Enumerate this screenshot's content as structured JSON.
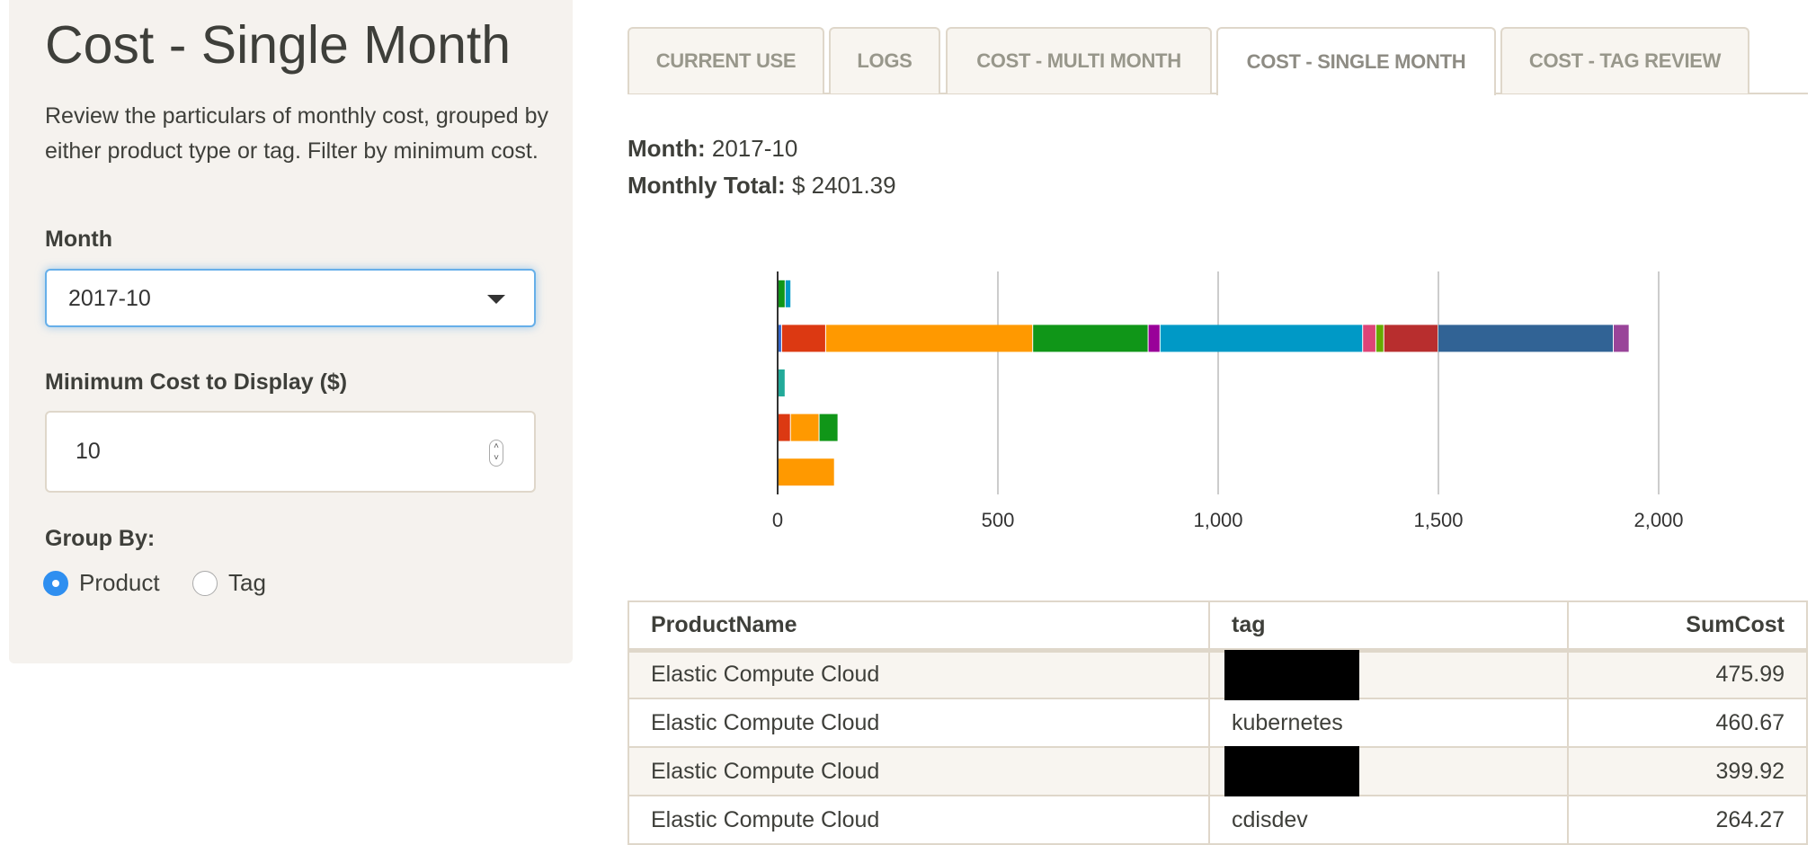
{
  "sidebar": {
    "title": "Cost - Single Month",
    "description": "Review the particulars of monthly cost, grouped by either product type or tag. Filter by minimum cost.",
    "month_label": "Month",
    "month_value": "2017-10",
    "min_cost_label": "Minimum Cost to Display ($)",
    "min_cost_value": "10",
    "group_by_label": "Group By:",
    "group_options": [
      {
        "label": "Product",
        "selected": true
      },
      {
        "label": "Tag",
        "selected": false
      }
    ]
  },
  "tabs": [
    {
      "label": "CURRENT USE",
      "active": false
    },
    {
      "label": "LOGS",
      "active": false
    },
    {
      "label": "COST - MULTI MONTH",
      "active": false
    },
    {
      "label": "COST - SINGLE MONTH",
      "active": true
    },
    {
      "label": "COST - TAG REVIEW",
      "active": false
    }
  ],
  "summary": {
    "month_label": "Month:",
    "month_value": "2017-10",
    "total_label": "Monthly Total:",
    "total_value": "$ 2401.39"
  },
  "chart_data": {
    "type": "bar",
    "orientation": "horizontal",
    "stacked": true,
    "xlim": [
      0,
      2000
    ],
    "x_ticks": [
      "0",
      "500",
      "1,000",
      "1,500",
      "2,000"
    ],
    "grid": true,
    "rows": [
      {
        "segments": [
          {
            "value": 18,
            "color": "#109618"
          },
          {
            "value": 13,
            "color": "#0099c6"
          }
        ]
      },
      {
        "segments": [
          {
            "value": 10,
            "color": "#3366cc"
          },
          {
            "value": 100,
            "color": "#dc3912"
          },
          {
            "value": 470,
            "color": "#ff9900"
          },
          {
            "value": 262,
            "color": "#109618"
          },
          {
            "value": 27,
            "color": "#990099"
          },
          {
            "value": 460,
            "color": "#0099c6"
          },
          {
            "value": 30,
            "color": "#dd4477"
          },
          {
            "value": 18,
            "color": "#66aa00"
          },
          {
            "value": 123,
            "color": "#b82e2e"
          },
          {
            "value": 398,
            "color": "#316395"
          },
          {
            "value": 36,
            "color": "#994499"
          }
        ]
      },
      {
        "segments": [
          {
            "value": 18,
            "color": "#22aa99"
          }
        ]
      },
      {
        "segments": [
          {
            "value": 30,
            "color": "#dc3912"
          },
          {
            "value": 65,
            "color": "#ff9900"
          },
          {
            "value": 43,
            "color": "#109618"
          }
        ]
      },
      {
        "segments": [
          {
            "value": 130,
            "color": "#ff9900"
          }
        ]
      }
    ]
  },
  "table": {
    "headers": [
      "ProductName",
      "tag",
      "SumCost"
    ],
    "rows": [
      {
        "product": "Elastic Compute Cloud",
        "tag": "",
        "redacted": true,
        "cost": "475.99"
      },
      {
        "product": "Elastic Compute Cloud",
        "tag": "kubernetes",
        "redacted": false,
        "cost": "460.67"
      },
      {
        "product": "Elastic Compute Cloud",
        "tag": "",
        "redacted": true,
        "cost": "399.92"
      },
      {
        "product": "Elastic Compute Cloud",
        "tag": "cdisdev",
        "redacted": false,
        "cost": "264.27"
      }
    ]
  }
}
